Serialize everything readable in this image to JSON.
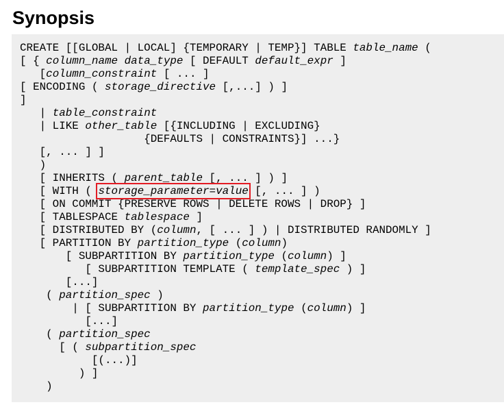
{
  "page": {
    "heading": "Synopsis"
  },
  "synopsis": {
    "lines": [
      [
        {
          "t": "CREATE [[GLOBAL | LOCAL] {TEMPORARY | TEMP}] TABLE "
        },
        {
          "t": "table_name",
          "s": "em"
        },
        {
          "t": " ("
        }
      ],
      [
        {
          "t": "[ { "
        },
        {
          "t": "column_name",
          "s": "em"
        },
        {
          "t": " "
        },
        {
          "t": "data_type",
          "s": "em"
        },
        {
          "t": " [ DEFAULT "
        },
        {
          "t": "default_expr",
          "s": "em"
        },
        {
          "t": " ]"
        }
      ],
      [
        {
          "t": "   ["
        },
        {
          "t": "column_constraint",
          "s": "em"
        },
        {
          "t": " [ ... ]"
        }
      ],
      [
        {
          "t": "[ ENCODING ( "
        },
        {
          "t": "storage_directive",
          "s": "em"
        },
        {
          "t": " [,...] ) ]"
        }
      ],
      [
        {
          "t": "]"
        }
      ],
      [
        {
          "t": "   | "
        },
        {
          "t": "table_constraint",
          "s": "em"
        }
      ],
      [
        {
          "t": "   | LIKE "
        },
        {
          "t": "other_table",
          "s": "em"
        },
        {
          "t": " [{INCLUDING | EXCLUDING}"
        }
      ],
      [
        {
          "t": "                   {DEFAULTS | CONSTRAINTS}] ...}"
        }
      ],
      [
        {
          "t": "   [, ... ] ]"
        }
      ],
      [
        {
          "t": "   )"
        }
      ],
      [
        {
          "t": "   [ INHERITS ( "
        },
        {
          "t": "parent_table",
          "s": "em"
        },
        {
          "t": " [, ... ] ) ]"
        }
      ],
      [
        {
          "t": "   [ WITH ( "
        },
        {
          "t": "storage_parameter=value",
          "s": "hl"
        },
        {
          "t": " [, ... ] )"
        }
      ],
      [
        {
          "t": "   [ ON COMMIT {PRESERVE ROWS | DELETE ROWS | DROP} ]"
        }
      ],
      [
        {
          "t": "   [ TABLESPACE "
        },
        {
          "t": "tablespace",
          "s": "em"
        },
        {
          "t": " ]"
        }
      ],
      [
        {
          "t": "   [ DISTRIBUTED BY ("
        },
        {
          "t": "column",
          "s": "em"
        },
        {
          "t": ", [ ... ] ) | DISTRIBUTED RANDOMLY ]"
        }
      ],
      [
        {
          "t": "   [ PARTITION BY "
        },
        {
          "t": "partition_type",
          "s": "em"
        },
        {
          "t": " ("
        },
        {
          "t": "column",
          "s": "em"
        },
        {
          "t": ")"
        }
      ],
      [
        {
          "t": "       [ SUBPARTITION BY "
        },
        {
          "t": "partition_type",
          "s": "em"
        },
        {
          "t": " ("
        },
        {
          "t": "column",
          "s": "em"
        },
        {
          "t": ") ]"
        }
      ],
      [
        {
          "t": "          [ SUBPARTITION TEMPLATE ( "
        },
        {
          "t": "template_spec",
          "s": "em"
        },
        {
          "t": " ) ]"
        }
      ],
      [
        {
          "t": "       [...]"
        }
      ],
      [
        {
          "t": "    ( "
        },
        {
          "t": "partition_spec",
          "s": "em"
        },
        {
          "t": " )"
        }
      ],
      [
        {
          "t": "        | [ SUBPARTITION BY "
        },
        {
          "t": "partition_type",
          "s": "em"
        },
        {
          "t": " ("
        },
        {
          "t": "column",
          "s": "em"
        },
        {
          "t": ") ]"
        }
      ],
      [
        {
          "t": "          [...]"
        }
      ],
      [
        {
          "t": "    ( "
        },
        {
          "t": "partition_spec",
          "s": "em"
        }
      ],
      [
        {
          "t": "      [ ( "
        },
        {
          "t": "subpartition_spec",
          "s": "em"
        }
      ],
      [
        {
          "t": "           [(...)]"
        }
      ],
      [
        {
          "t": "         ) ]"
        }
      ],
      [
        {
          "t": "    )"
        }
      ]
    ]
  }
}
